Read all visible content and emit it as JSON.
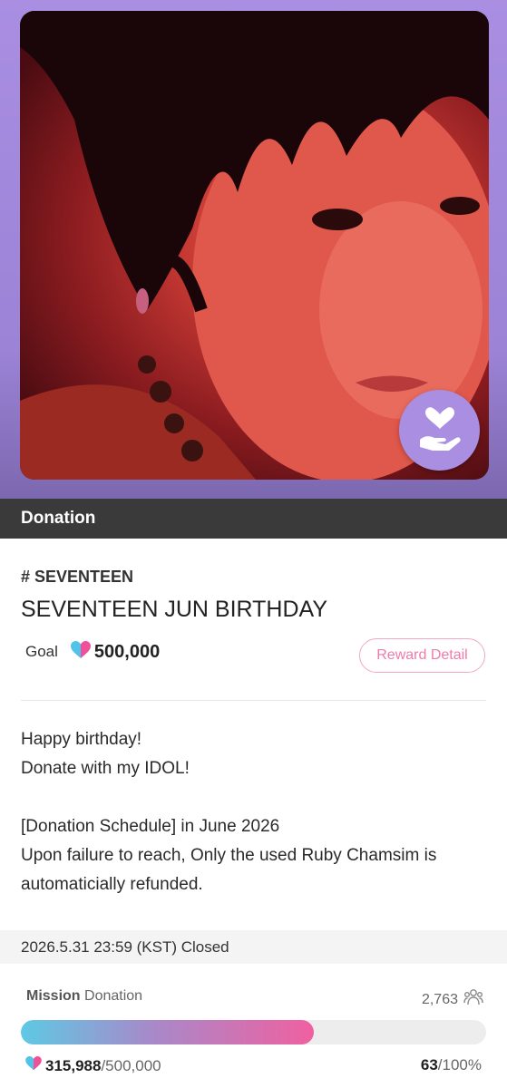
{
  "hero": {
    "badge_icon": "donation-hand-heart-icon"
  },
  "section": {
    "label": "Donation"
  },
  "campaign": {
    "tag": "# SEVENTEEN",
    "title": "SEVENTEEN JUN BIRTHDAY",
    "goal_label": "Goal",
    "goal_value": "500,000",
    "reward_button": "Reward Detail",
    "description": {
      "line1": "Happy birthday!",
      "line2": "Donate with my IDOL!",
      "line3": "[Donation Schedule] in June 2026",
      "line4": "Upon failure to reach, Only the used Ruby Chamsim is automaticially refunded."
    },
    "closed_text": "2026.5.31 23:59 (KST) Closed"
  },
  "mission": {
    "label_bold": "Mission",
    "label_rest": "Donation",
    "participants": "2,763",
    "raised": "315,988",
    "goal": "/500,000",
    "percent": "63",
    "percent_suffix": "/100%",
    "progress_fraction": 0.63
  },
  "colors": {
    "accent_pink": "#f07aa8",
    "accent_purple": "#a98ee2",
    "heart_blue": "#4fc3e8",
    "heart_pink": "#f0509a"
  }
}
